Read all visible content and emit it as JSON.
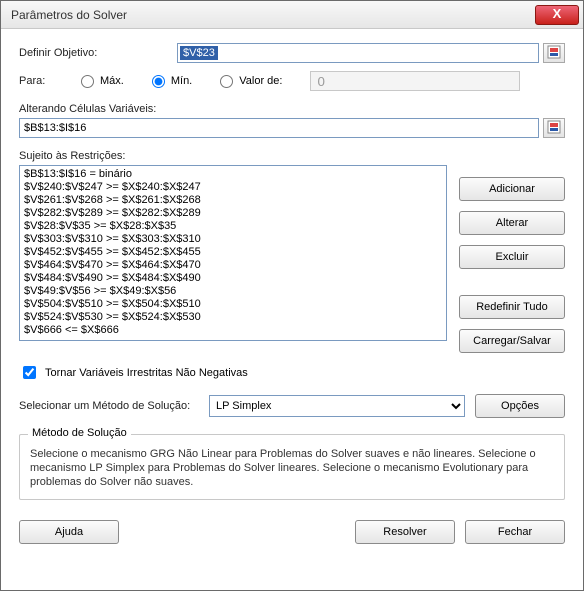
{
  "titlebar": {
    "title": "Parâmetros do Solver",
    "close": "X"
  },
  "objective": {
    "label": "Definir Objetivo:",
    "value": "$V$23"
  },
  "target": {
    "label": "Para:",
    "max": "Máx.",
    "min": "Mín.",
    "valueof": "Valor de:",
    "selected": "min",
    "valueof_value": "0"
  },
  "varcells": {
    "label": "Alterando Células Variáveis:",
    "value": "$B$13:$I$16"
  },
  "constraints": {
    "label": "Sujeito às Restrições:",
    "items": [
      "$B$13:$I$16 = binário",
      "$V$240:$V$247 >= $X$240:$X$247",
      "$V$261:$V$268 >= $X$261:$X$268",
      "$V$282:$V$289 >= $X$282:$X$289",
      "$V$28:$V$35 >= $X$28:$X$35",
      "$V$303:$V$310 >= $X$303:$X$310",
      "$V$452:$V$455 >= $X$452:$X$455",
      "$V$464:$V$470 >= $X$464:$X$470",
      "$V$484:$V$490 >= $X$484:$X$490",
      "$V$49:$V$56 >= $X$49:$X$56",
      "$V$504:$V$510 >= $X$504:$X$510",
      "$V$524:$V$530 >= $X$524:$X$530",
      "$V$666 <= $X$666"
    ]
  },
  "side": {
    "add": "Adicionar",
    "change": "Alterar",
    "delete": "Excluir",
    "reset": "Redefinir Tudo",
    "loadsave": "Carregar/Salvar"
  },
  "nonneg": {
    "label": "Tornar Variáveis Irrestritas Não Negativas",
    "checked": true
  },
  "method": {
    "label": "Selecionar um Método de Solução:",
    "value": "LP Simplex",
    "options_btn": "Opções"
  },
  "group": {
    "legend": "Método de Solução",
    "text": "Selecione o mecanismo GRG Não Linear para Problemas do Solver suaves e não lineares. Selecione o mecanismo LP Simplex para Problemas do Solver lineares. Selecione o mecanismo Evolutionary para problemas do Solver não suaves."
  },
  "footer": {
    "help": "Ajuda",
    "solve": "Resolver",
    "close": "Fechar"
  }
}
